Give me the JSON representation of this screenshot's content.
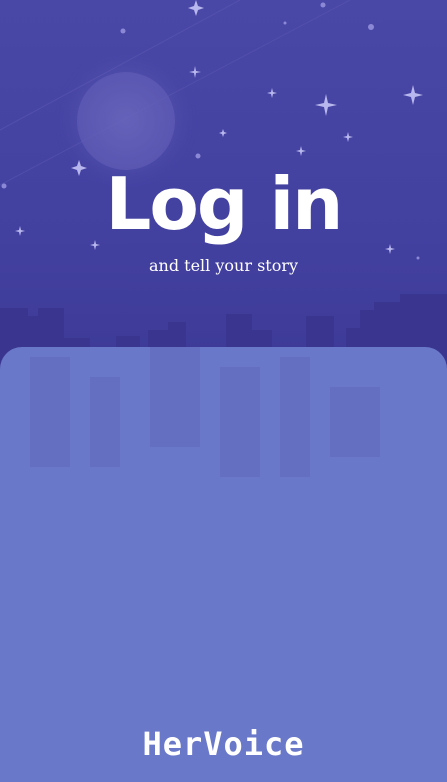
{
  "header": {
    "title": "Log in",
    "subtitle": "and tell your story"
  },
  "footer": {
    "brand": "HerVoice"
  },
  "colors": {
    "sky": "#4341a0",
    "panel": "#6a78c9",
    "text": "#ffffff"
  }
}
